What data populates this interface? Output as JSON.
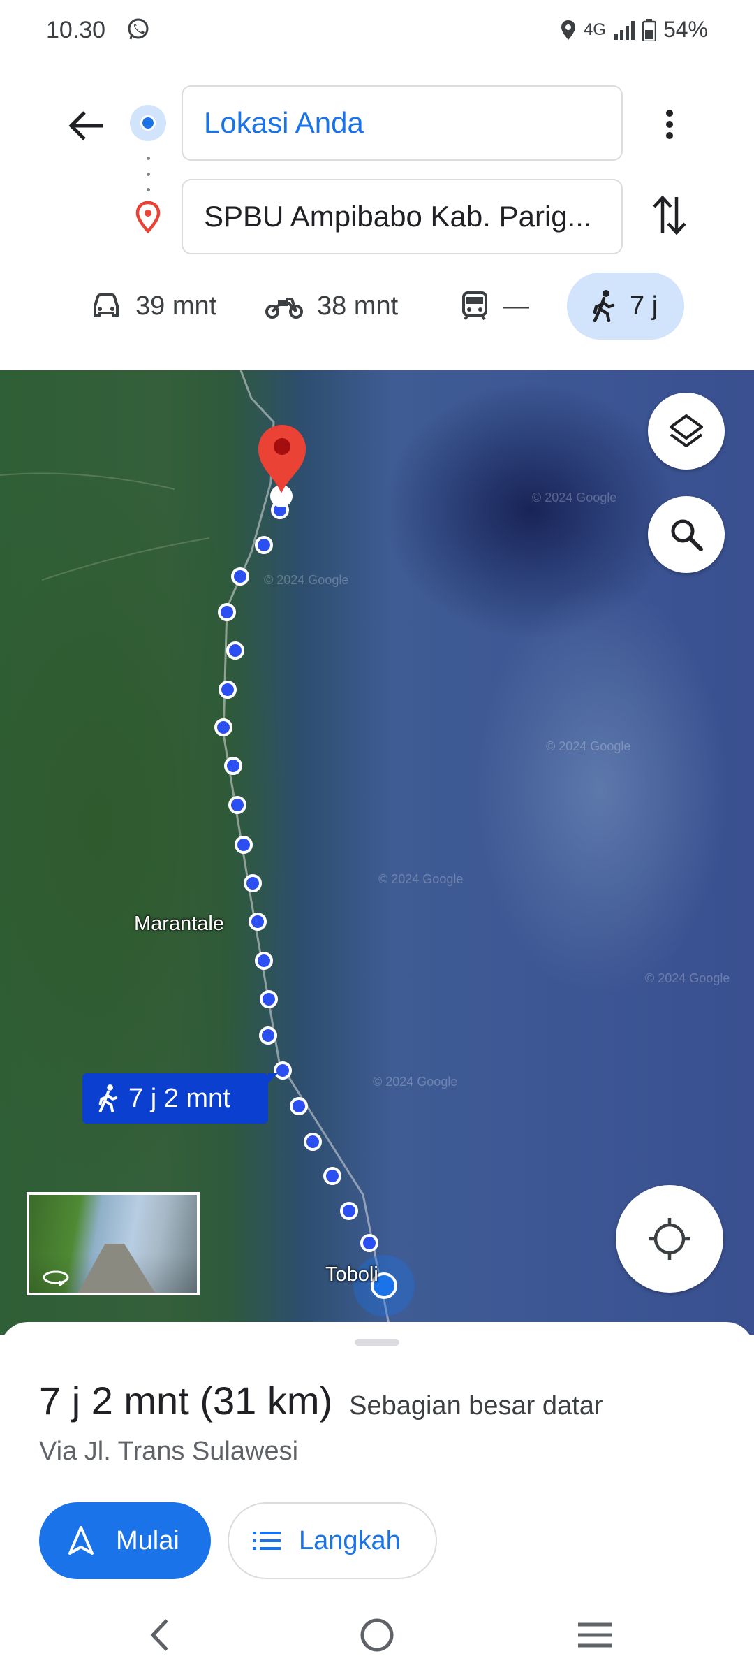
{
  "status_bar": {
    "time": "10.30",
    "network": "4G",
    "battery": "54%"
  },
  "directions": {
    "origin": "Lokasi Anda",
    "destination": "SPBU Ampibabo Kab. Parig..."
  },
  "travel_modes": [
    {
      "mode": "car",
      "icon": "car-icon",
      "time": "39 mnt"
    },
    {
      "mode": "motorcycle",
      "icon": "motorcycle-icon",
      "time": "38 mnt"
    },
    {
      "mode": "transit",
      "icon": "train-icon",
      "time": "—"
    },
    {
      "mode": "walk",
      "icon": "walk-icon",
      "time": "7 j",
      "selected": true
    }
  ],
  "map": {
    "watermark": "© 2024 Google",
    "places": {
      "marantale": "Marantale",
      "toboli": "Toboli"
    },
    "route_bubble": "7 j 2 mnt"
  },
  "summary": {
    "duration_distance": "7 j 2 mnt (31 km)",
    "terrain": "Sebagian besar datar",
    "via": "Via Jl. Trans Sulawesi"
  },
  "actions": {
    "start": "Mulai",
    "steps": "Langkah"
  },
  "colors": {
    "accent": "#1a73e8",
    "route_dot": "#2b4ff0",
    "selected_mode_bg": "#d2e3fc",
    "destination_pin": "#ea4335"
  }
}
